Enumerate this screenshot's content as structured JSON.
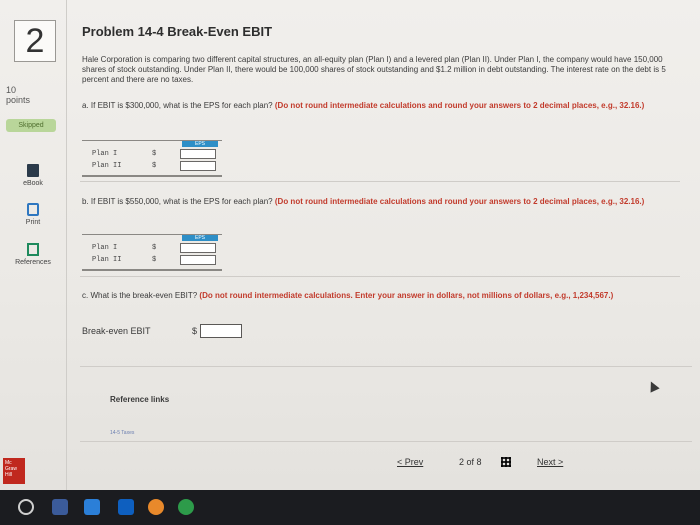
{
  "sidebar": {
    "question_number": "2",
    "points_value": "10",
    "points_label": "points",
    "status": "Skipped",
    "tools": [
      {
        "label": "eBook",
        "icon": "book-icon"
      },
      {
        "label": "Print",
        "icon": "printer-icon"
      },
      {
        "label": "References",
        "icon": "references-icon"
      }
    ],
    "logo_text": "Mc Graw Hill"
  },
  "problem": {
    "title": "Problem 14-4 Break-Even EBIT",
    "intro": "Hale Corporation is comparing two different capital structures, an all-equity plan (Plan I) and a levered plan (Plan II). Under Plan I, the company would have 150,000 shares of stock outstanding. Under Plan II, there would be 100,000 shares of stock outstanding and $1.2 million in debt outstanding. The interest rate on the debt is 5 percent and there are no taxes."
  },
  "part_a": {
    "question": "a. If EBIT is $300,000, what is the EPS for each plan?",
    "instruction": "(Do not round intermediate calculations and round your answers to 2 decimal places, e.g., 32.16.)",
    "header": "EPS",
    "rows": [
      {
        "label": "Plan I",
        "currency": "$",
        "value": ""
      },
      {
        "label": "Plan II",
        "currency": "$",
        "value": ""
      }
    ]
  },
  "part_b": {
    "question": "b. If EBIT is $550,000, what is the EPS for each plan?",
    "instruction": "(Do not round intermediate calculations and round your answers to 2 decimal places, e.g., 32.16.)",
    "header": "EPS",
    "rows": [
      {
        "label": "Plan I",
        "currency": "$",
        "value": ""
      },
      {
        "label": "Plan II",
        "currency": "$",
        "value": ""
      }
    ]
  },
  "part_c": {
    "question": "c. What is the break-even EBIT?",
    "instruction": "(Do not round intermediate calculations. Enter your answer in dollars, not millions of dollars, e.g., 1,234,567.)",
    "label": "Break-even EBIT",
    "currency": "$",
    "value": ""
  },
  "references": {
    "heading": "Reference links",
    "link": "14-5 Taxes"
  },
  "pager": {
    "prev": "< Prev",
    "status": "2 of 8",
    "next": "Next >"
  }
}
